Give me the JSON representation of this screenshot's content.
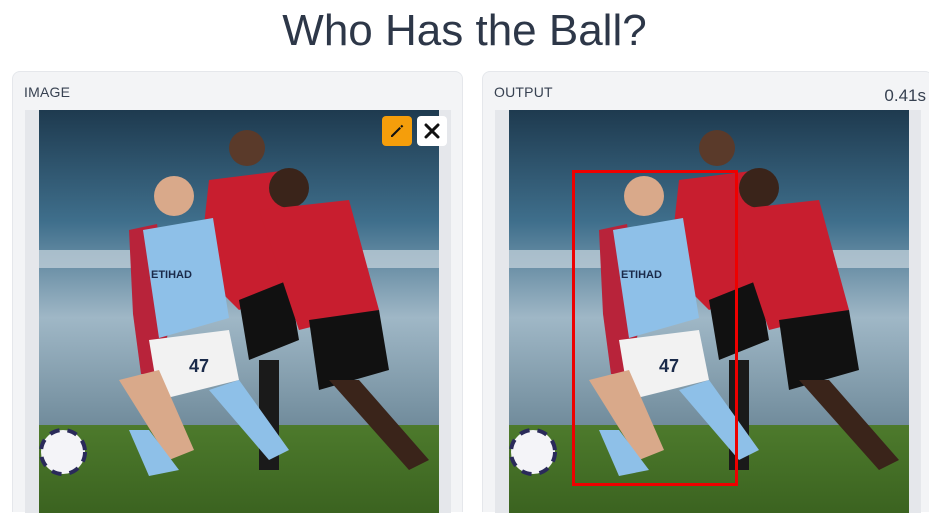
{
  "page": {
    "title": "Who Has the Ball?"
  },
  "input_panel": {
    "label": "IMAGE",
    "edit_icon": "pencil-icon",
    "clear_icon": "close-icon"
  },
  "output_panel": {
    "label": "OUTPUT",
    "timing": "0.41s",
    "detection_color": "#ee0000"
  },
  "photo": {
    "description_icon": "football-players-photo",
    "shirt_text": "ETIHAD",
    "shirt_number": "47"
  },
  "colors": {
    "accent": "#f59e0b",
    "title": "#2d3748",
    "panel_bg": "#f3f4f6"
  }
}
